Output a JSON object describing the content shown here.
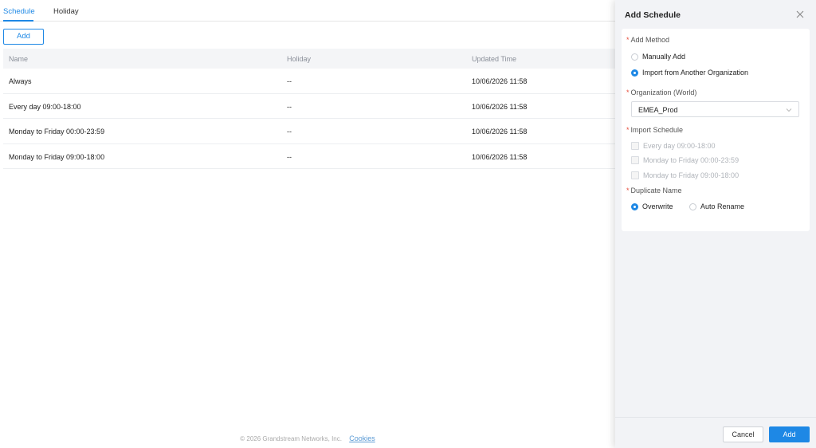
{
  "tabs": [
    {
      "label": "Schedule",
      "active": true
    },
    {
      "label": "Holiday",
      "active": false
    }
  ],
  "toolbar": {
    "add_label": "Add"
  },
  "table": {
    "headers": [
      "Name",
      "Holiday",
      "Updated Time"
    ],
    "rows": [
      [
        "Always",
        "--",
        "10/06/2026 11:58"
      ],
      [
        "Every day 09:00-18:00",
        "--",
        "10/06/2026 11:58"
      ],
      [
        "Monday to Friday 00:00-23:59",
        "--",
        "10/06/2026 11:58"
      ],
      [
        "Monday to Friday 09:00-18:00",
        "--",
        "10/06/2026 11:58"
      ]
    ]
  },
  "footer": {
    "copyright": "© 2026 Grandstream Networks, Inc.",
    "cookies": "Cookies"
  },
  "drawer": {
    "title": "Add Schedule",
    "required_mark": "*",
    "add_method": {
      "label": "Add Method",
      "options": [
        "Manually Add",
        "Import from Another Organization"
      ],
      "selected": "Import from Another Organization"
    },
    "organization": {
      "label": "Organization (World)",
      "value": "EMEA_Prod"
    },
    "import_schedule": {
      "label": "Import Schedule",
      "items": [
        "Every day 09:00-18:00",
        "Monday to Friday 00:00-23:59",
        "Monday to Friday 09:00-18:00"
      ]
    },
    "duplicate_name": {
      "label": "Duplicate Name",
      "options": [
        "Overwrite",
        "Auto Rename"
      ],
      "selected": "Overwrite"
    },
    "cancel_label": "Cancel",
    "add_label": "Add"
  },
  "colors": {
    "accent": "#1e88e5",
    "required": "#e74c3c"
  },
  "icons": {
    "close": "close-icon",
    "dropdown": "chevron-down-icon"
  }
}
